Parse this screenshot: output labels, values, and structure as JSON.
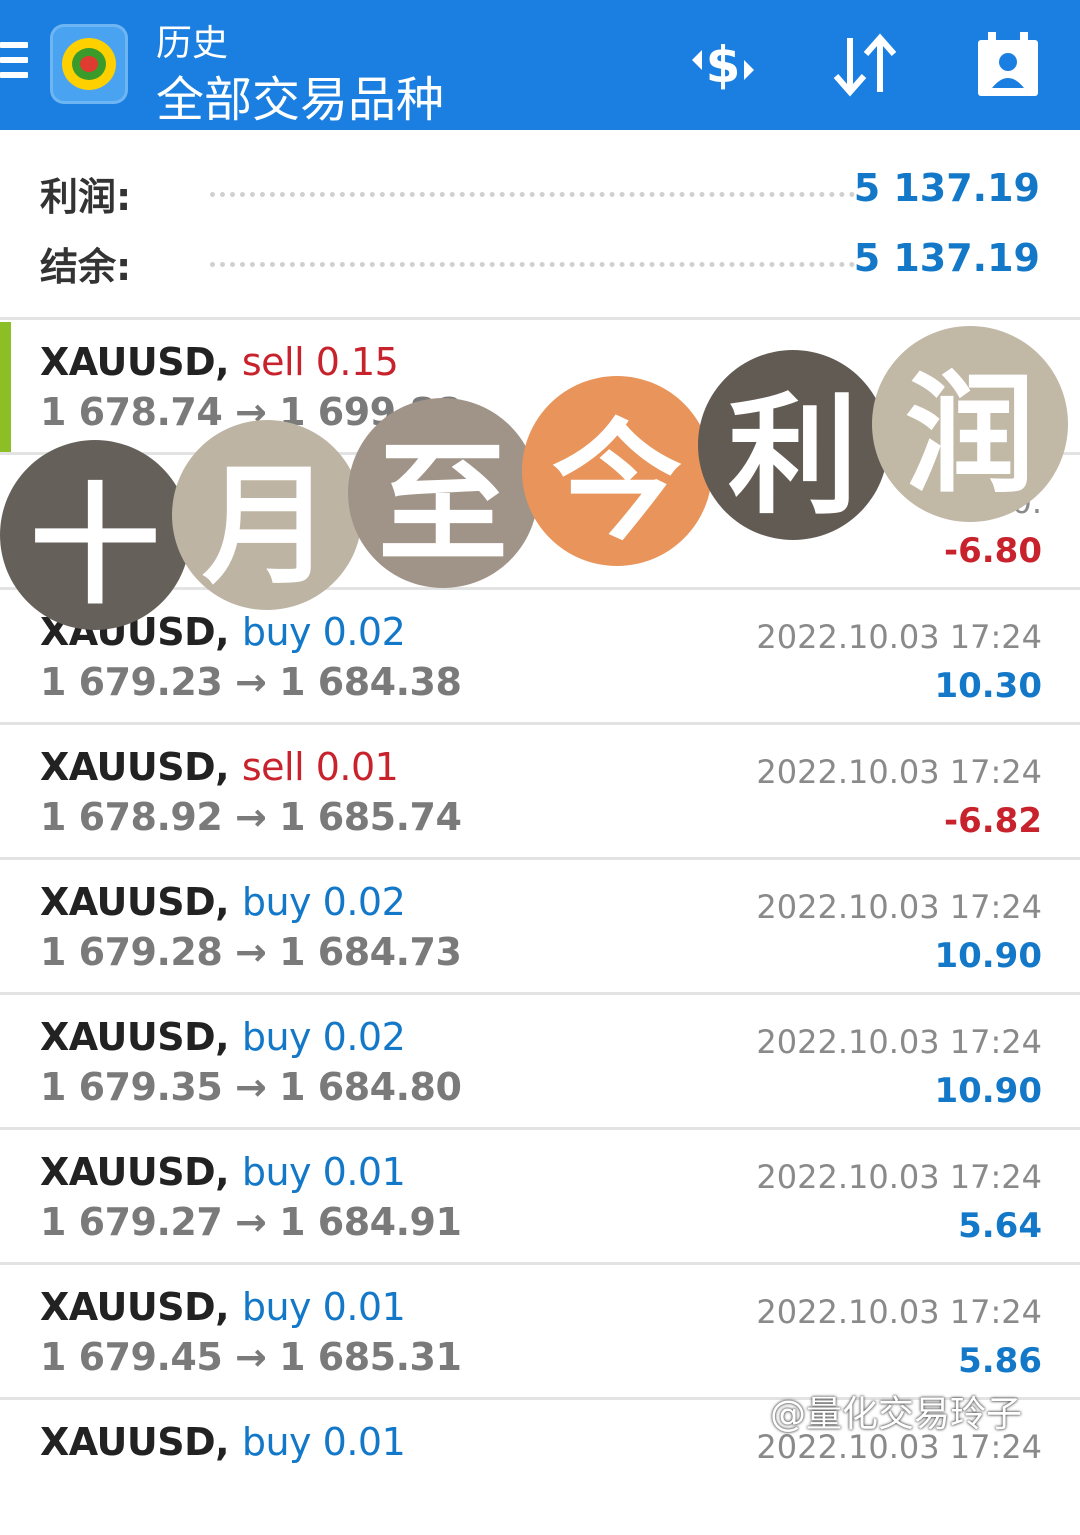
{
  "header": {
    "subtitle": "历史",
    "title": "全部交易品种",
    "icons": [
      "menu-icon",
      "currency-swap-icon",
      "sort-icon",
      "calendar-person-icon"
    ]
  },
  "summary": {
    "profit_label": "利润:",
    "profit_value": "5 137.19",
    "balance_label": "结余:",
    "balance_value": "5 137.19"
  },
  "trades": [
    {
      "symbol": "XAUUSD,",
      "side": "sell",
      "volume": "0.15",
      "open": "1 678.74",
      "close": "1 699.88",
      "time": "2022.1",
      "profit": ""
    },
    {
      "symbol": "",
      "side": "",
      "volume": "",
      "open": "",
      "close": "",
      "time": "2.10.",
      "profit": "-6.80"
    },
    {
      "symbol": "XAUUSD,",
      "side": "buy",
      "volume": "0.02",
      "open": "1 679.23",
      "close": "1 684.38",
      "time": "2022.10.03 17:24",
      "profit": "10.30"
    },
    {
      "symbol": "XAUUSD,",
      "side": "sell",
      "volume": "0.01",
      "open": "1 678.92",
      "close": "1 685.74",
      "time": "2022.10.03 17:24",
      "profit": "-6.82"
    },
    {
      "symbol": "XAUUSD,",
      "side": "buy",
      "volume": "0.02",
      "open": "1 679.28",
      "close": "1 684.73",
      "time": "2022.10.03 17:24",
      "profit": "10.90"
    },
    {
      "symbol": "XAUUSD,",
      "side": "buy",
      "volume": "0.02",
      "open": "1 679.35",
      "close": "1 684.80",
      "time": "2022.10.03 17:24",
      "profit": "10.90"
    },
    {
      "symbol": "XAUUSD,",
      "side": "buy",
      "volume": "0.01",
      "open": "1 679.27",
      "close": "1 684.91",
      "time": "2022.10.03 17:24",
      "profit": "5.64"
    },
    {
      "symbol": "XAUUSD,",
      "side": "buy",
      "volume": "0.01",
      "open": "1 679.45",
      "close": "1 685.31",
      "time": "2022.10.03 17:24",
      "profit": "5.86"
    },
    {
      "symbol": "XAUUSD,",
      "side": "buy",
      "volume": "0.01",
      "open": "",
      "close": "",
      "time": "2022.10.03 17:24",
      "profit": ""
    }
  ],
  "overlay": {
    "chars": [
      "十",
      "月",
      "至",
      "今",
      "利",
      "润"
    ],
    "colors": [
      "#66605a",
      "#bdb4a3",
      "#a09488",
      "#e8945a",
      "#615b54",
      "#c1b8a6"
    ]
  },
  "watermark": "@量化交易玲子",
  "colors": {
    "accent": "#1a7fe0",
    "positive": "#1478c8",
    "negative": "#c8232c"
  }
}
